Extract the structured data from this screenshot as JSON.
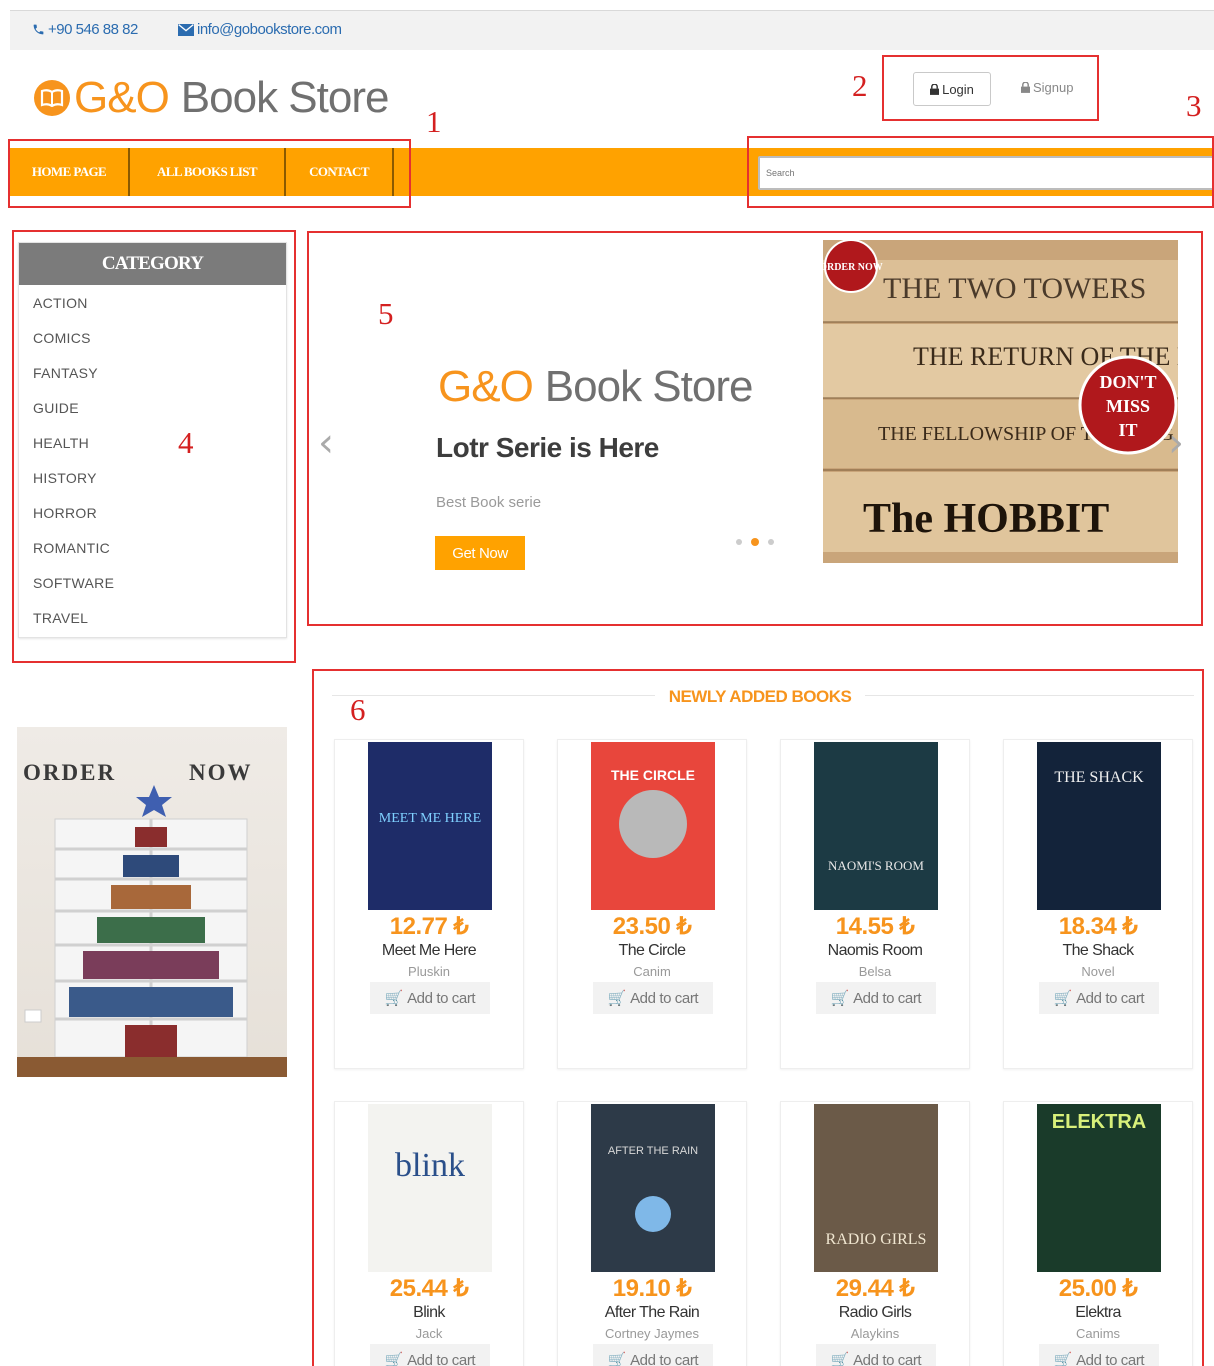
{
  "contact": {
    "phone": "+90 546 88 82",
    "email": "info@gobookstore.com"
  },
  "logo": {
    "brand": "G&O",
    "name": "Book Store"
  },
  "auth": {
    "login": "Login",
    "signup": "Signup"
  },
  "nav": [
    "HOME PAGE",
    "ALL BOOKS LIST",
    "CONTACT"
  ],
  "search": {
    "placeholder": "Search"
  },
  "category": {
    "title": "CATEGORY",
    "items": [
      "ACTION",
      "COMICS",
      "FANTASY",
      "GUIDE",
      "HEALTH",
      "HISTORY",
      "HORROR",
      "ROMANTIC",
      "SOFTWARE",
      "TRAVEL"
    ]
  },
  "ad": {
    "left": "ORDER",
    "right": "NOW"
  },
  "slider": {
    "brand": "G&O",
    "name": "Book Store",
    "headline": "Lotr Serie is Here",
    "sub": "Best Book serie",
    "button": "Get Now",
    "prev": "‹",
    "next": "›",
    "image": {
      "badge_top": "ORDER NOW",
      "badge_line1": "DON'T",
      "badge_line2": "MISS",
      "badge_line3": "IT",
      "spine1": "THE TWO TOWERS",
      "spine2": "THE RETURN OF THE KING",
      "spine3": "THE FELLOWSHIP OF THE RING",
      "spine4": "The HOBBIT"
    }
  },
  "newly": {
    "title": "NEWLY ADDED BOOKS",
    "cart_label": "Add to cart",
    "books": [
      {
        "price": "12.77 ₺",
        "name": "Meet Me Here",
        "author": "Pluskin",
        "cover_text": "MEET ME HERE",
        "cover_color": "#1e2c68"
      },
      {
        "price": "23.50 ₺",
        "name": "The Circle",
        "author": "Canim",
        "cover_text": "THE CIRCLE",
        "cover_color": "#e8463c"
      },
      {
        "price": "14.55 ₺",
        "name": "Naomis Room",
        "author": "Belsa",
        "cover_text": "NAOMI'S ROOM",
        "cover_color": "#1c3a44"
      },
      {
        "price": "18.34 ₺",
        "name": "The Shack",
        "author": "Novel",
        "cover_text": "THE SHACK",
        "cover_color": "#13233a"
      },
      {
        "price": "25.44 ₺",
        "name": "Blink",
        "author": "Jack",
        "cover_text": "blink",
        "cover_color": "#f3f3f0"
      },
      {
        "price": "19.10 ₺",
        "name": "After The Rain",
        "author": "Cortney Jaymes",
        "cover_text": "AFTER THE RAIN",
        "cover_color": "#2d3a48"
      },
      {
        "price": "29.44 ₺",
        "name": "Radio Girls",
        "author": "Alaykins",
        "cover_text": "RADIO GIRLS",
        "cover_color": "#6b5a48"
      },
      {
        "price": "25.00 ₺",
        "name": "Elektra",
        "author": "Canims",
        "cover_text": "ELEKTRA",
        "cover_color": "#1a3b2a"
      }
    ]
  },
  "annotations": [
    "1",
    "2",
    "3",
    "4",
    "5",
    "6"
  ],
  "colors": {
    "accent": "#ffa200",
    "brand": "#f7941d",
    "category_head": "#7b7b7b",
    "annotation": "#e53030"
  }
}
